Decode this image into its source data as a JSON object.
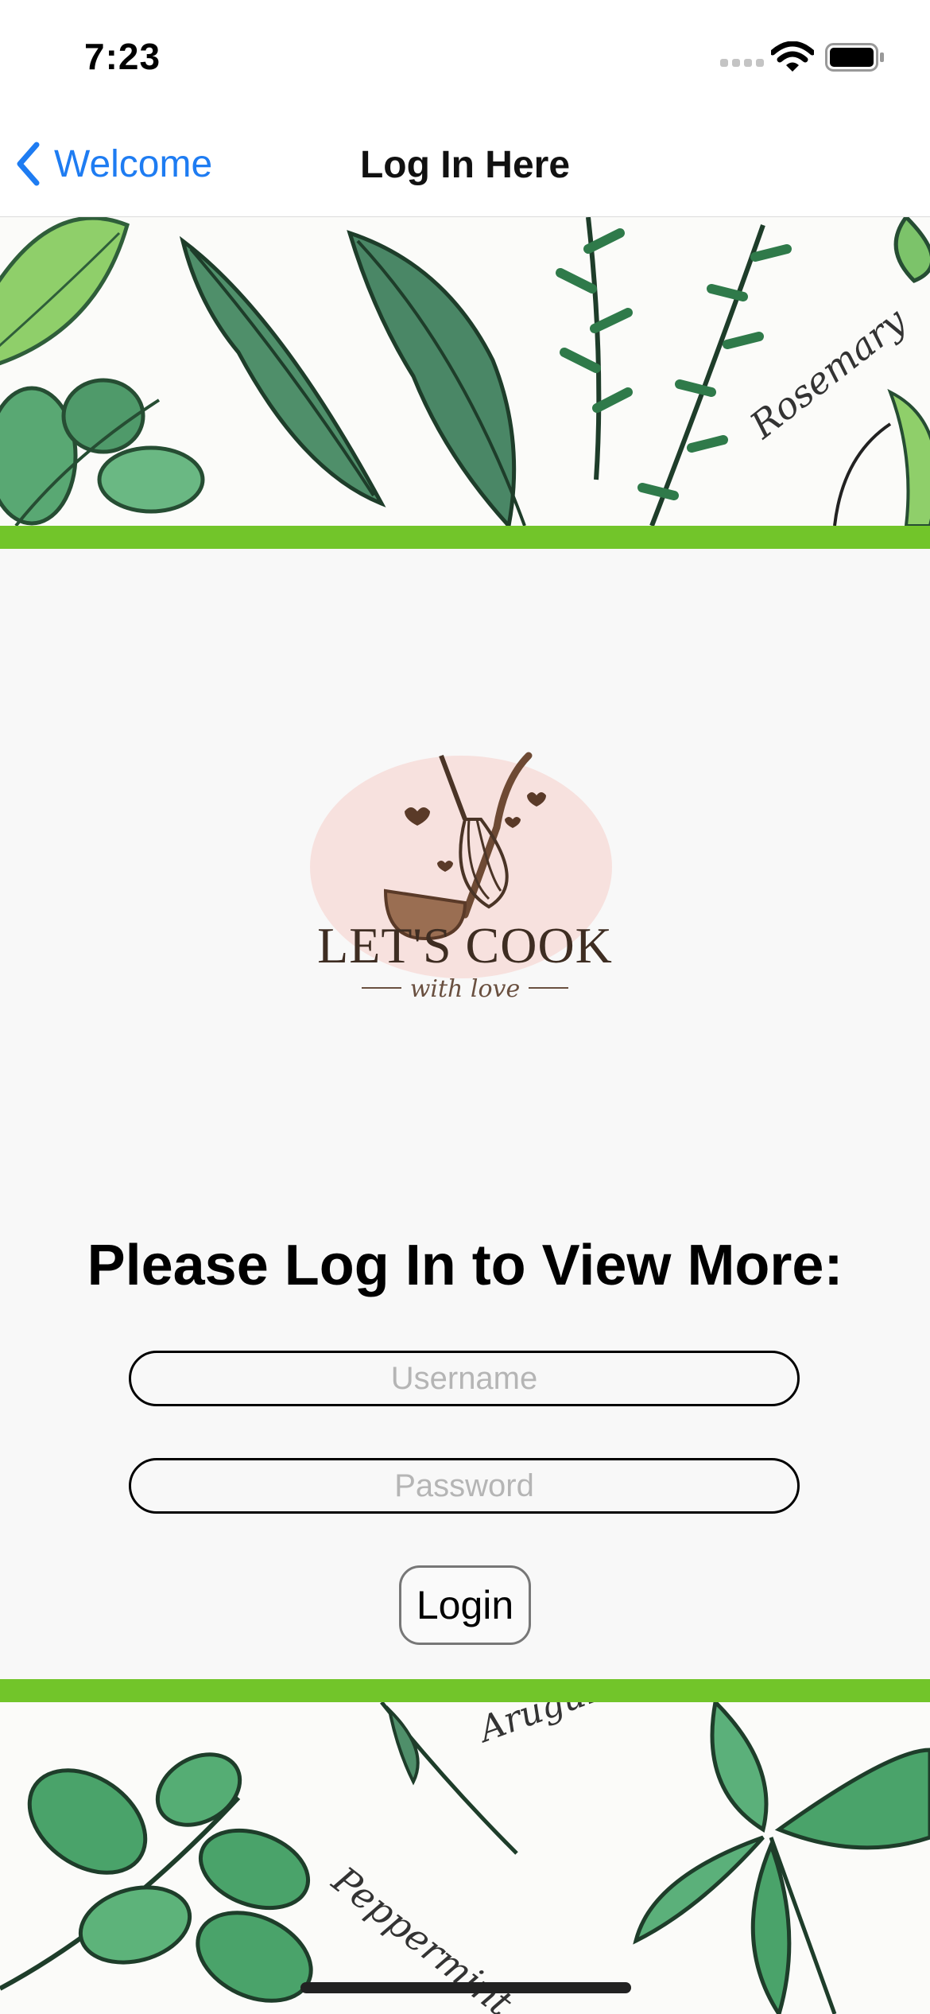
{
  "status_bar": {
    "time": "7:23"
  },
  "nav": {
    "back_label": "Welcome",
    "title": "Log In Here"
  },
  "banner_top": {
    "herb_label": "Rosemary"
  },
  "logo": {
    "title": "LET'S COOK",
    "subtitle": "with love"
  },
  "headline": "Please Log In to View More:",
  "form": {
    "username_placeholder": "Username",
    "password_placeholder": "Password",
    "login_label": "Login"
  },
  "banner_bottom": {
    "herb_label_1": "Arugula",
    "herb_label_2": "Peppermint"
  },
  "colors": {
    "accent_blue": "#1e7cf2",
    "stripe_green": "#72c52a",
    "herb_green": "#4f9a6a"
  },
  "icons": [
    "chevron-left-icon",
    "signal-icon",
    "wifi-icon",
    "battery-icon"
  ]
}
